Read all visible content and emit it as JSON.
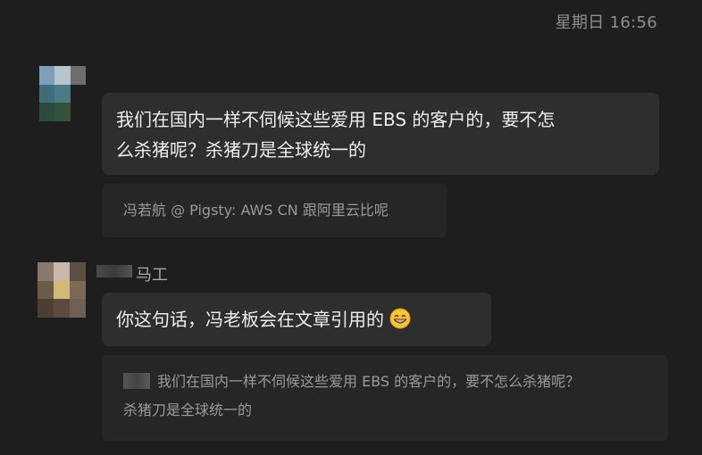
{
  "header": {
    "timestamp": "星期日 16:56"
  },
  "messages": [
    {
      "text_line1": "我们在国内一样不伺候这些爱用 EBS 的客户的，要不怎",
      "text_line2": "么杀猪呢？杀猪刀是全球统一的",
      "quote": "冯若航 @ Pigsty: AWS CN 跟阿里云比呢"
    },
    {
      "sender": "马工",
      "text": "你这句话，冯老板会在文章引用的",
      "emoji": "grinning-face-icon",
      "quote_line1": "我们在国内一样不伺候这些爱用 EBS 的客户的，要不怎么杀猪呢？",
      "quote_line2": "杀猪刀是全球统一的"
    }
  ],
  "colors": {
    "background": "#1e1e1e",
    "bubble": "#2e2e2e",
    "quote": "#262626"
  }
}
